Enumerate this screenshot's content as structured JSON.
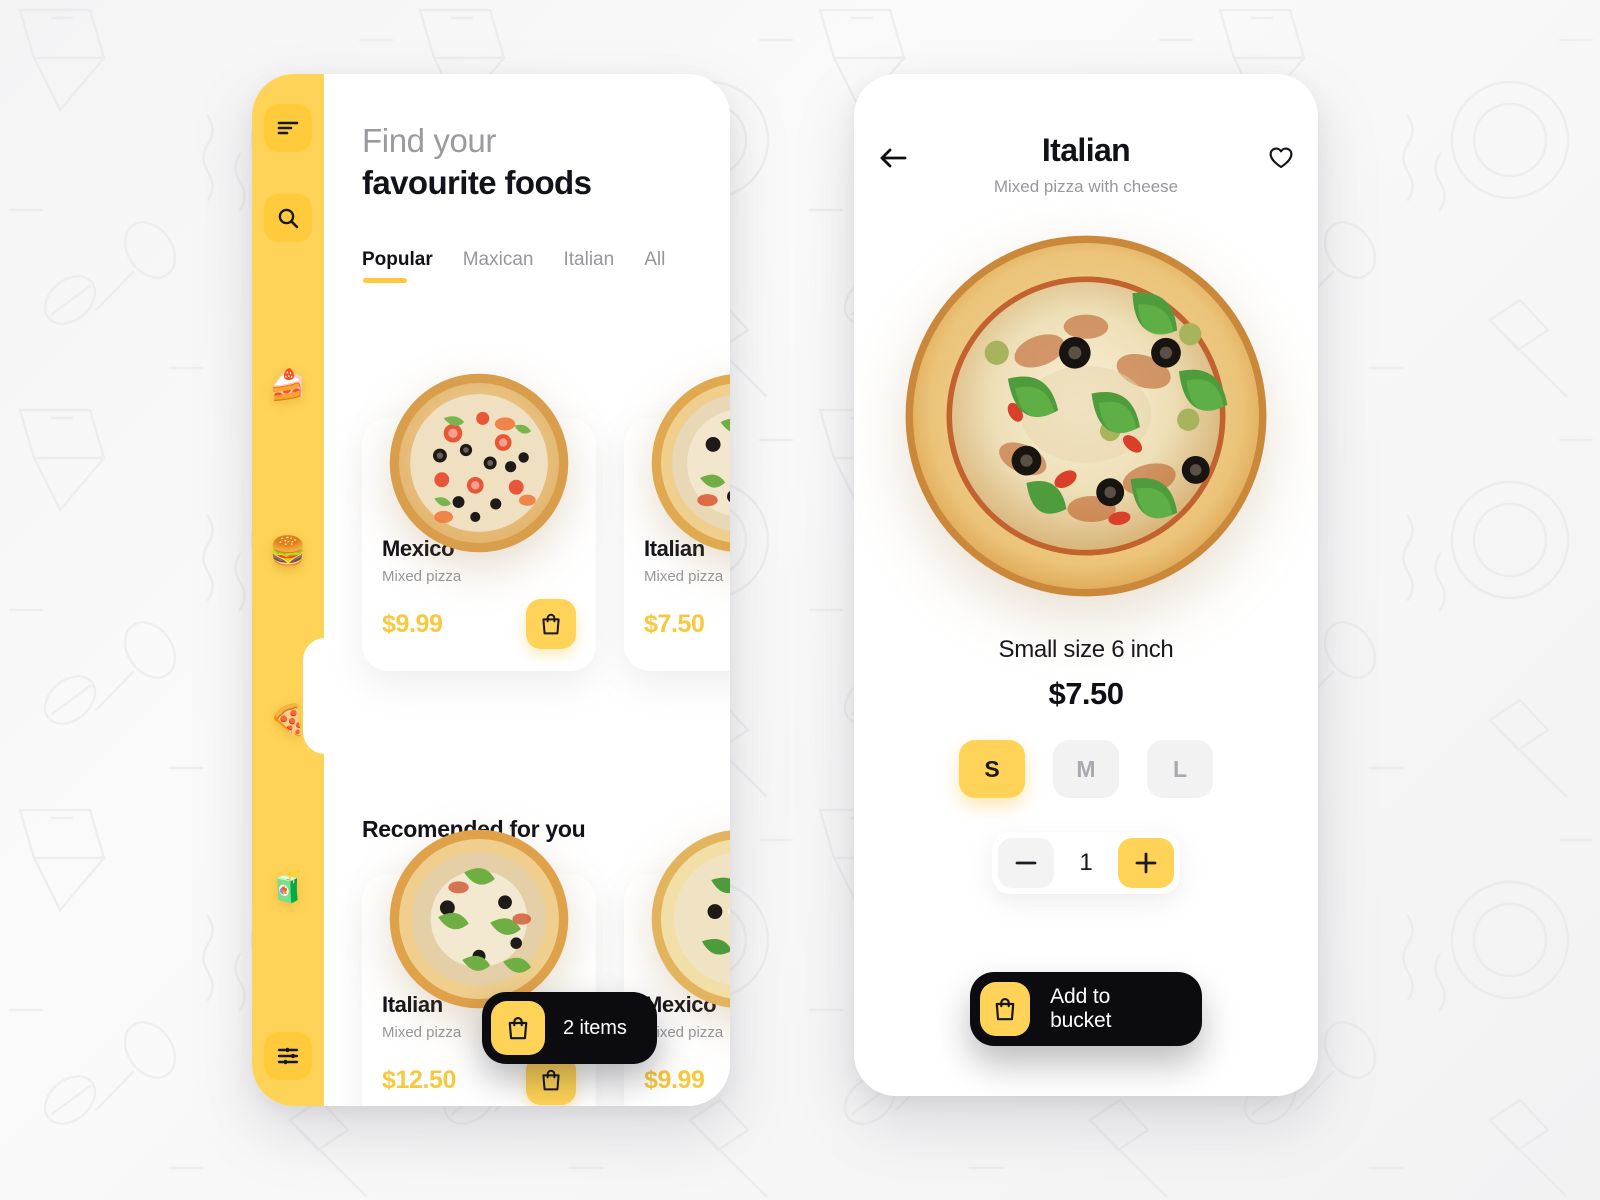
{
  "theme": {
    "accent": "#FFD357",
    "accent_deep": "#F7C93F",
    "dark": "#0C0C10",
    "text": "#12121A",
    "muted": "#97979D",
    "chip_bg": "#F2F2F3"
  },
  "home": {
    "sidebar": {
      "menu_icon": "hamburger-menu-icon",
      "search_icon": "search-icon",
      "categories": [
        {
          "key": "dessert",
          "icon": "cake-slice-icon",
          "glyph": "🍰",
          "active": false
        },
        {
          "key": "burger",
          "icon": "burger-icon",
          "glyph": "🍔",
          "active": false
        },
        {
          "key": "pizza",
          "icon": "pizza-slice-icon",
          "glyph": "🍕",
          "active": true
        },
        {
          "key": "drinks",
          "icon": "juice-bottle-icon",
          "glyph": "🧃",
          "active": false
        }
      ],
      "settings_icon": "sliders-settings-icon"
    },
    "heading_line1": "Find your",
    "heading_line2": "favourite foods",
    "tabs": [
      {
        "label": "Popular",
        "active": true
      },
      {
        "label": "Maxican",
        "active": false
      },
      {
        "label": "Italian",
        "active": false
      },
      {
        "label": "All",
        "active": false
      }
    ],
    "popular": [
      {
        "title": "Mexico",
        "subtitle": "Mixed pizza",
        "price": "$9.99",
        "bag_icon": "shopping-bag-icon"
      },
      {
        "title": "Italian",
        "subtitle": "Mixed pizza",
        "price": "$7.50",
        "bag_icon": "shopping-bag-icon"
      }
    ],
    "recommended_title": "Recomended for you",
    "recommended": [
      {
        "title": "Italian",
        "subtitle": "Mixed pizza",
        "price": "$12.50",
        "bag_icon": "shopping-bag-icon"
      },
      {
        "title": "Mexico",
        "subtitle": "Mixed pizza",
        "price": "$9.99",
        "bag_icon": "shopping-bag-icon"
      }
    ],
    "cart": {
      "icon": "shopping-bag-icon",
      "label": "2 items"
    }
  },
  "detail": {
    "back_icon": "arrow-left-icon",
    "favourite_icon": "heart-outline-icon",
    "title": "Italian",
    "subtitle": "Mixed pizza with cheese",
    "hero_alt": "pizza-photo",
    "size_label": "Small size 6 inch",
    "price": "$7.50",
    "sizes": [
      {
        "label": "S",
        "active": true
      },
      {
        "label": "M",
        "active": false
      },
      {
        "label": "L",
        "active": false
      }
    ],
    "quantity": {
      "minus_icon": "minus-icon",
      "value": "1",
      "plus_icon": "plus-icon"
    },
    "cta": {
      "icon": "shopping-bag-icon",
      "label": "Add to bucket"
    }
  }
}
